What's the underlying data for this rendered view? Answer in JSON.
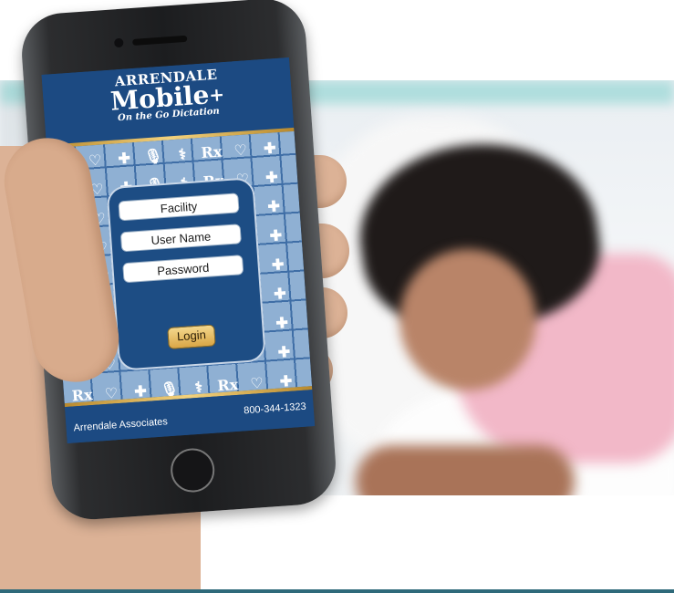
{
  "app": {
    "logo_line1": "ARRENDALE",
    "logo_line2": "Mobile",
    "logo_plus": "+",
    "logo_tagline": "On the Go Dictation"
  },
  "login": {
    "facility_placeholder": "Facility",
    "username_placeholder": "User Name",
    "password_placeholder": "Password",
    "login_label": "Login"
  },
  "footer": {
    "company": "Arrendale Associates",
    "phone": "800-344-1323"
  },
  "pattern_icons": [
    "Rx",
    "✚",
    "⚕",
    "♡",
    "🎙"
  ],
  "colors": {
    "brand_blue": "#1c4a82",
    "gold": "#e2b452",
    "pattern_blue": "#8fb0d3"
  }
}
